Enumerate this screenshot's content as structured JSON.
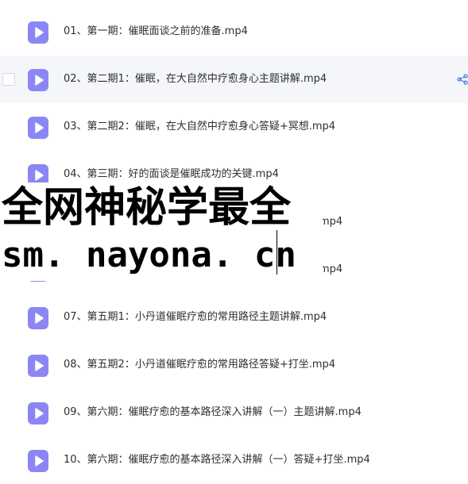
{
  "files": [
    {
      "name": "01、第一期：催眠面谈之前的准备.mp4",
      "icon": "video-file-icon"
    },
    {
      "name": "02、第二期1：催眠，在大自然中疗愈身心主题讲解.mp4",
      "icon": "video-file-icon",
      "hovered": true
    },
    {
      "name": "03、第二期2：催眠，在大自然中疗愈身心答疑+冥想.mp4",
      "icon": "video-file-icon"
    },
    {
      "name": "04、第三期：好的面谈是催眠成功的关键.mp4",
      "icon": "video-file-icon"
    },
    {
      "name": "mp4",
      "icon": "video-file-icon"
    },
    {
      "name": "mp4",
      "icon": "video-file-icon"
    },
    {
      "name": "07、第五期1：小丹道催眠疗愈的常用路径主题讲解.mp4",
      "icon": "video-file-icon"
    },
    {
      "name": "08、第五期2：小丹道催眠疗愈的常用路径答疑+打坐.mp4",
      "icon": "video-file-icon"
    },
    {
      "name": "09、第六期：催眠疗愈的基本路径深入讲解（一）主题讲解.mp4",
      "icon": "video-file-icon"
    },
    {
      "name": "10、第六期：催眠疗愈的基本路径深入讲解（一）答疑+打坐.mp4",
      "icon": "video-file-icon"
    }
  ],
  "watermark": {
    "title": "全网神秘学最全",
    "url": "sm. nayona. cn"
  },
  "colors": {
    "icon_accent": "#8c86f5",
    "hover_row": "#f5f6fa",
    "text": "#2b2f36",
    "share_icon": "#4a7cf0"
  }
}
